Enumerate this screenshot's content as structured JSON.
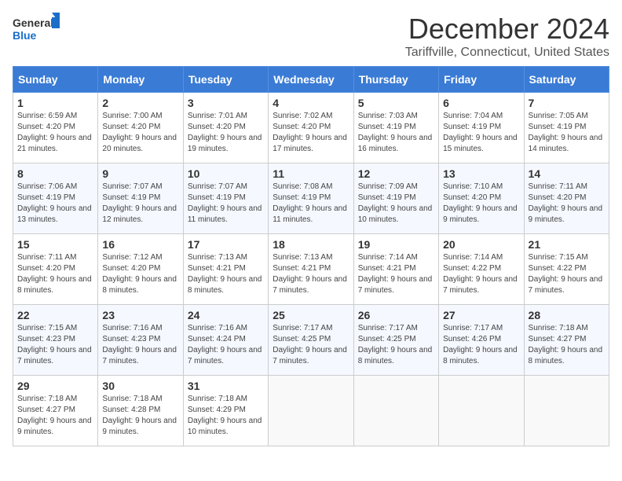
{
  "header": {
    "logo_line1": "General",
    "logo_line2": "Blue",
    "month": "December 2024",
    "location": "Tariffville, Connecticut, United States"
  },
  "weekdays": [
    "Sunday",
    "Monday",
    "Tuesday",
    "Wednesday",
    "Thursday",
    "Friday",
    "Saturday"
  ],
  "weeks": [
    [
      {
        "day": "1",
        "sunrise": "6:59 AM",
        "sunset": "4:20 PM",
        "daylight": "9 hours and 21 minutes."
      },
      {
        "day": "2",
        "sunrise": "7:00 AM",
        "sunset": "4:20 PM",
        "daylight": "9 hours and 20 minutes."
      },
      {
        "day": "3",
        "sunrise": "7:01 AM",
        "sunset": "4:20 PM",
        "daylight": "9 hours and 19 minutes."
      },
      {
        "day": "4",
        "sunrise": "7:02 AM",
        "sunset": "4:20 PM",
        "daylight": "9 hours and 17 minutes."
      },
      {
        "day": "5",
        "sunrise": "7:03 AM",
        "sunset": "4:19 PM",
        "daylight": "9 hours and 16 minutes."
      },
      {
        "day": "6",
        "sunrise": "7:04 AM",
        "sunset": "4:19 PM",
        "daylight": "9 hours and 15 minutes."
      },
      {
        "day": "7",
        "sunrise": "7:05 AM",
        "sunset": "4:19 PM",
        "daylight": "9 hours and 14 minutes."
      }
    ],
    [
      {
        "day": "8",
        "sunrise": "7:06 AM",
        "sunset": "4:19 PM",
        "daylight": "9 hours and 13 minutes."
      },
      {
        "day": "9",
        "sunrise": "7:07 AM",
        "sunset": "4:19 PM",
        "daylight": "9 hours and 12 minutes."
      },
      {
        "day": "10",
        "sunrise": "7:07 AM",
        "sunset": "4:19 PM",
        "daylight": "9 hours and 11 minutes."
      },
      {
        "day": "11",
        "sunrise": "7:08 AM",
        "sunset": "4:19 PM",
        "daylight": "9 hours and 11 minutes."
      },
      {
        "day": "12",
        "sunrise": "7:09 AM",
        "sunset": "4:19 PM",
        "daylight": "9 hours and 10 minutes."
      },
      {
        "day": "13",
        "sunrise": "7:10 AM",
        "sunset": "4:20 PM",
        "daylight": "9 hours and 9 minutes."
      },
      {
        "day": "14",
        "sunrise": "7:11 AM",
        "sunset": "4:20 PM",
        "daylight": "9 hours and 9 minutes."
      }
    ],
    [
      {
        "day": "15",
        "sunrise": "7:11 AM",
        "sunset": "4:20 PM",
        "daylight": "9 hours and 8 minutes."
      },
      {
        "day": "16",
        "sunrise": "7:12 AM",
        "sunset": "4:20 PM",
        "daylight": "9 hours and 8 minutes."
      },
      {
        "day": "17",
        "sunrise": "7:13 AM",
        "sunset": "4:21 PM",
        "daylight": "9 hours and 8 minutes."
      },
      {
        "day": "18",
        "sunrise": "7:13 AM",
        "sunset": "4:21 PM",
        "daylight": "9 hours and 7 minutes."
      },
      {
        "day": "19",
        "sunrise": "7:14 AM",
        "sunset": "4:21 PM",
        "daylight": "9 hours and 7 minutes."
      },
      {
        "day": "20",
        "sunrise": "7:14 AM",
        "sunset": "4:22 PM",
        "daylight": "9 hours and 7 minutes."
      },
      {
        "day": "21",
        "sunrise": "7:15 AM",
        "sunset": "4:22 PM",
        "daylight": "9 hours and 7 minutes."
      }
    ],
    [
      {
        "day": "22",
        "sunrise": "7:15 AM",
        "sunset": "4:23 PM",
        "daylight": "9 hours and 7 minutes."
      },
      {
        "day": "23",
        "sunrise": "7:16 AM",
        "sunset": "4:23 PM",
        "daylight": "9 hours and 7 minutes."
      },
      {
        "day": "24",
        "sunrise": "7:16 AM",
        "sunset": "4:24 PM",
        "daylight": "9 hours and 7 minutes."
      },
      {
        "day": "25",
        "sunrise": "7:17 AM",
        "sunset": "4:25 PM",
        "daylight": "9 hours and 7 minutes."
      },
      {
        "day": "26",
        "sunrise": "7:17 AM",
        "sunset": "4:25 PM",
        "daylight": "9 hours and 8 minutes."
      },
      {
        "day": "27",
        "sunrise": "7:17 AM",
        "sunset": "4:26 PM",
        "daylight": "9 hours and 8 minutes."
      },
      {
        "day": "28",
        "sunrise": "7:18 AM",
        "sunset": "4:27 PM",
        "daylight": "9 hours and 8 minutes."
      }
    ],
    [
      {
        "day": "29",
        "sunrise": "7:18 AM",
        "sunset": "4:27 PM",
        "daylight": "9 hours and 9 minutes."
      },
      {
        "day": "30",
        "sunrise": "7:18 AM",
        "sunset": "4:28 PM",
        "daylight": "9 hours and 9 minutes."
      },
      {
        "day": "31",
        "sunrise": "7:18 AM",
        "sunset": "4:29 PM",
        "daylight": "9 hours and 10 minutes."
      },
      null,
      null,
      null,
      null
    ]
  ],
  "labels": {
    "sunrise": "Sunrise:",
    "sunset": "Sunset:",
    "daylight": "Daylight:"
  }
}
